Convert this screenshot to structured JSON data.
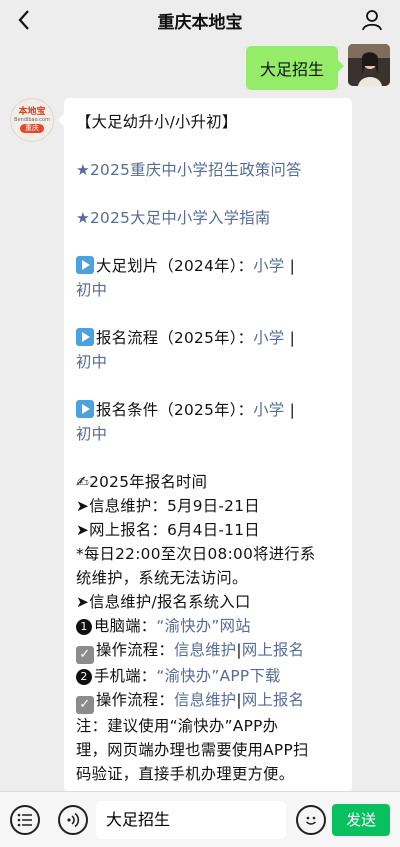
{
  "header": {
    "title": "重庆本地宝"
  },
  "outgoing": {
    "text": "大足招生"
  },
  "bot_avatar": {
    "logo_top": "本地宝",
    "logo_mid": "Bendibao.com",
    "logo_bottom": "重庆"
  },
  "message": {
    "heading": "【大足幼升小/小升初】",
    "faq_link": "★2025重庆中小学招生政策问答",
    "guide_link": "★2025大足中小学入学指南",
    "zone": {
      "label": "大足划片（2024年）：",
      "link1": "小学",
      "sep": "|",
      "link2": "初中"
    },
    "flow": {
      "label": "报名流程（2025年）：",
      "link1": "小学",
      "sep": "|",
      "link2": "初中"
    },
    "cond": {
      "label": "报名条件（2025年）：",
      "link1": "小学",
      "sep": "|",
      "link2": "初中"
    },
    "time_title": "✍2025年报名时间",
    "info_maint": "➤信息维护：5月9日-21日",
    "online_reg": "➤网上报名：6月4日-11日",
    "maint_note_1": "*每日22:00至次日08:00将进行系",
    "maint_note_2": "统维护，系统无法访问。",
    "entry_title": "➤信息维护/报名系统入口",
    "pc": {
      "num": "1",
      "label": "电脑端：",
      "link": "“渝快办”网站"
    },
    "op1": {
      "label": "操作流程：",
      "link1": "信息维护",
      "sep": "|",
      "link2": "网上报名"
    },
    "mobile": {
      "num": "2",
      "label": "手机端：",
      "link": "“渝快办”APP下载"
    },
    "op2": {
      "label": "操作流程：",
      "link1": "信息维护",
      "sep": "|",
      "link2": "网上报名"
    },
    "note_1": "注：建议使用“渝快办”APP办",
    "note_2": "理，网页端办理也需要使用APP扫",
    "note_3": "码验证，直接手机办理更方便。"
  },
  "input": {
    "value": "大足招生"
  },
  "send": {
    "label": "发送"
  }
}
